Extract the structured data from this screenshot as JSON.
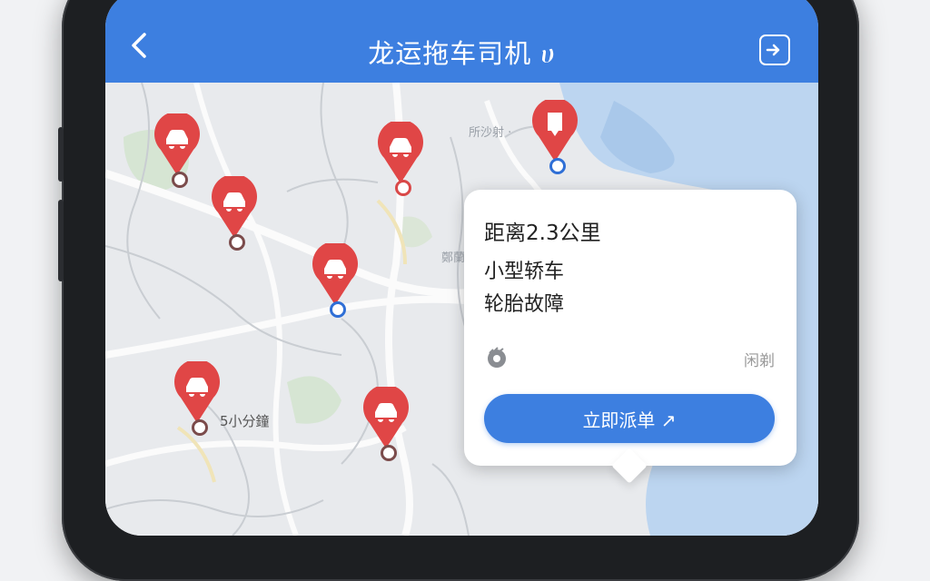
{
  "header": {
    "back_icon": "chevron-left-icon",
    "title": "龙运拖车司机 ሀ",
    "exit_icon": "exit-icon"
  },
  "map": {
    "labels": {
      "eta": "5小分鐘",
      "district_1": "所沙射 ·",
      "district_2": "鄭蘭"
    },
    "marker_icon": "car-icon",
    "target_marker_icon": "flag-icon",
    "colors": {
      "marker_red": "#e04646",
      "water": "#bcd5f0",
      "accent": "#3d7fe0"
    }
  },
  "card": {
    "distance": "距离2.3公里",
    "vehicle": "小型轿车",
    "fault": "轮胎故障",
    "tire_icon": "tire-icon",
    "note": "闲剃",
    "dispatch_label": "立即派单 ↗"
  }
}
